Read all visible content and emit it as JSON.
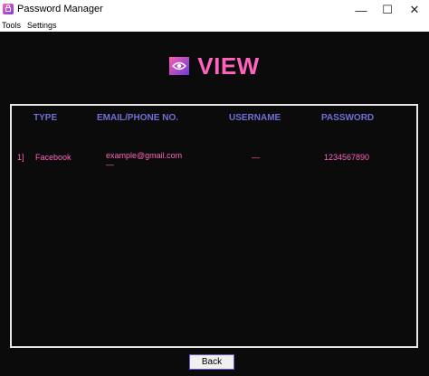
{
  "window": {
    "title": "Password Manager",
    "minimize_glyph": "—",
    "maximize_glyph": "☐",
    "close_glyph": "✕"
  },
  "menu": {
    "items": [
      "Tools",
      "Settings"
    ]
  },
  "header": {
    "title": "VIEW",
    "icon": "eye-icon"
  },
  "table": {
    "columns": [
      "TYPE",
      "EMAIL/PHONE NO.",
      "USERNAME",
      "PASSWORD"
    ],
    "rows": [
      {
        "index": "1]",
        "type": "Facebook",
        "email": "example@gmail.com",
        "email_extra": "—",
        "username": "—",
        "password": "1234567890"
      }
    ]
  },
  "footer": {
    "back_label": "Back"
  },
  "colors": {
    "background": "#0b0b0b",
    "accent_pink": "#ff63bd",
    "header_blue": "#6f6fd8"
  }
}
